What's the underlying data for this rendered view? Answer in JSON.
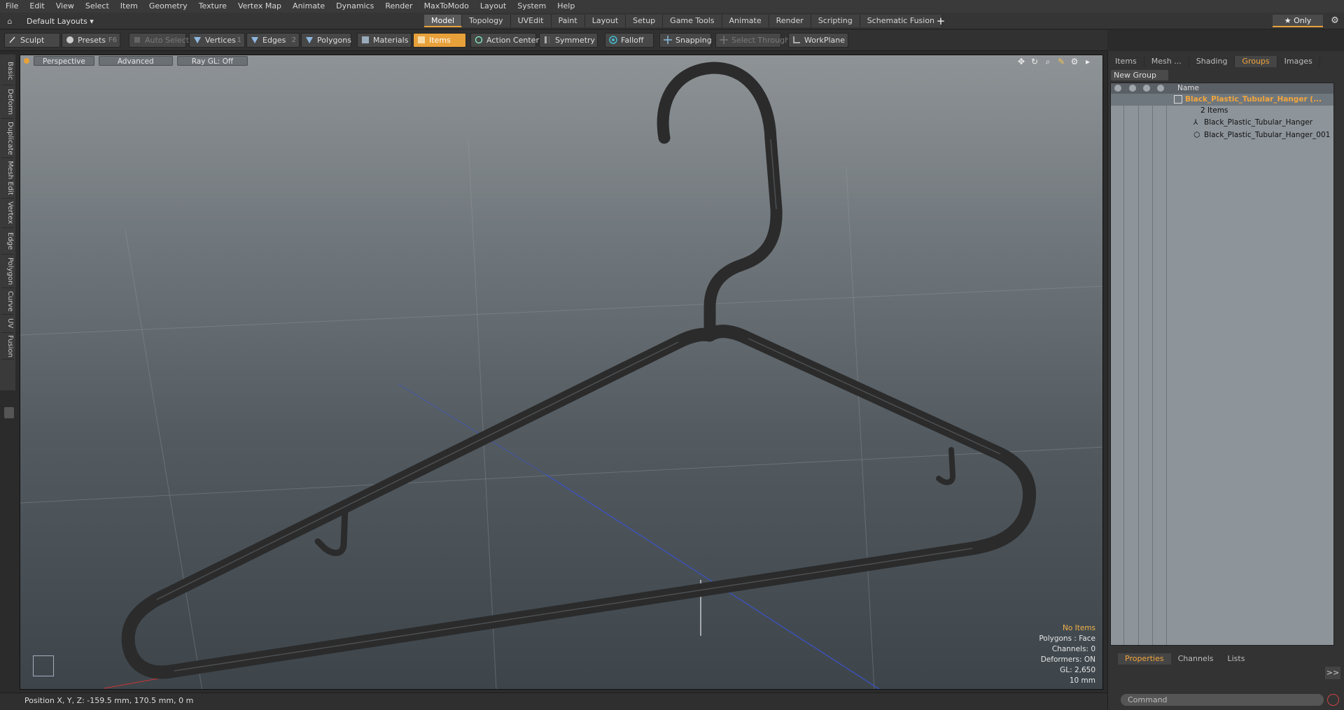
{
  "menu": [
    "File",
    "Edit",
    "View",
    "Select",
    "Item",
    "Geometry",
    "Texture",
    "Vertex Map",
    "Animate",
    "Dynamics",
    "Render",
    "MaxToModo",
    "Layout",
    "System",
    "Help"
  ],
  "layout_selector": "Default Layouts ▾",
  "mode_tabs": [
    {
      "label": "Model",
      "active": true
    },
    {
      "label": "Topology"
    },
    {
      "label": "UVEdit"
    },
    {
      "label": "Paint"
    },
    {
      "label": "Layout"
    },
    {
      "label": "Setup"
    },
    {
      "label": "Game Tools"
    },
    {
      "label": "Animate"
    },
    {
      "label": "Render"
    },
    {
      "label": "Scripting"
    },
    {
      "label": "Schematic Fusion"
    }
  ],
  "add_tab": "+",
  "only_button": "★ Only",
  "toolbar": {
    "sculpt": "Sculpt",
    "presets": "Presets",
    "presets_key": "F6",
    "auto_select": "Auto Select",
    "vertices": "Vertices",
    "vertices_key": "1",
    "edges": "Edges",
    "edges_key": "2",
    "polygons": "Polygons",
    "materials": "Materials",
    "items": "Items",
    "action_center": "Action Center",
    "symmetry": "Symmetry",
    "falloff": "Falloff",
    "snapping": "Snapping",
    "select_through": "Select Through",
    "workplane": "WorkPlane"
  },
  "left_tabs": [
    "Basic",
    "Deform",
    "Duplicate",
    "Mesh Edit",
    "Vertex",
    "Edge",
    "Polygon",
    "Curve",
    "UV",
    "Fusion"
  ],
  "viewport": {
    "view": "Perspective",
    "shading": "Advanced",
    "raygl": "Ray GL: Off",
    "info": {
      "no_items": "No Items",
      "polygons": "Polygons : Face",
      "channels": "Channels: 0",
      "deformers": "Deformers: ON",
      "gl": "GL: 2,650",
      "scale": "10 mm"
    }
  },
  "status": "Position X, Y, Z:   -159.5 mm, 170.5 mm, 0 m",
  "right_panel": {
    "tabs": [
      {
        "label": "Items"
      },
      {
        "label": "Mesh ..."
      },
      {
        "label": "Shading"
      },
      {
        "label": "Groups",
        "active": true
      },
      {
        "label": "Images"
      }
    ],
    "new_group": "New Group",
    "column_name": "Name",
    "group": {
      "name": "Black_Plastic_Tubular_Hanger (...",
      "count": "2 Items",
      "children": [
        "Black_Plastic_Tubular_Hanger",
        "Black_Plastic_Tubular_Hanger_001"
      ]
    },
    "bottom_tabs": [
      {
        "label": "Properties",
        "active": true
      },
      {
        "label": "Channels"
      },
      {
        "label": "Lists"
      }
    ],
    "command_placeholder": "Command",
    "expand": ">>"
  },
  "colors": {
    "accent": "#e8a13a",
    "hanger": "#2a2a2a"
  }
}
